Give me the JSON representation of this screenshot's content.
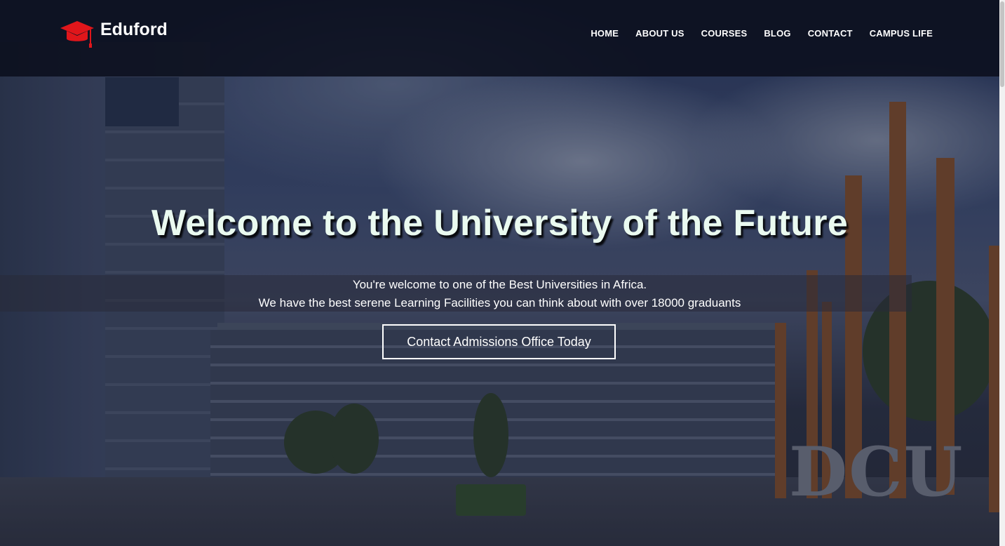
{
  "brand": {
    "name": "Eduford",
    "icon": "graduation-cap-icon",
    "accent_color": "#e0161b"
  },
  "nav": {
    "items": [
      {
        "label": "HOME"
      },
      {
        "label": "ABOUT US"
      },
      {
        "label": "COURSES"
      },
      {
        "label": "BLOG"
      },
      {
        "label": "CONTACT"
      },
      {
        "label": "CAMPUS LIFE"
      }
    ]
  },
  "hero": {
    "title": "Welcome to the University of the Future",
    "tagline_line1": "You're welcome to one of the Best Universities in Africa.",
    "tagline_line2": "We have the best serene Learning Facilities you can think about with over 18000 graduants",
    "cta_label": "Contact Admissions Office Today",
    "background_sign_text": "DCU"
  }
}
